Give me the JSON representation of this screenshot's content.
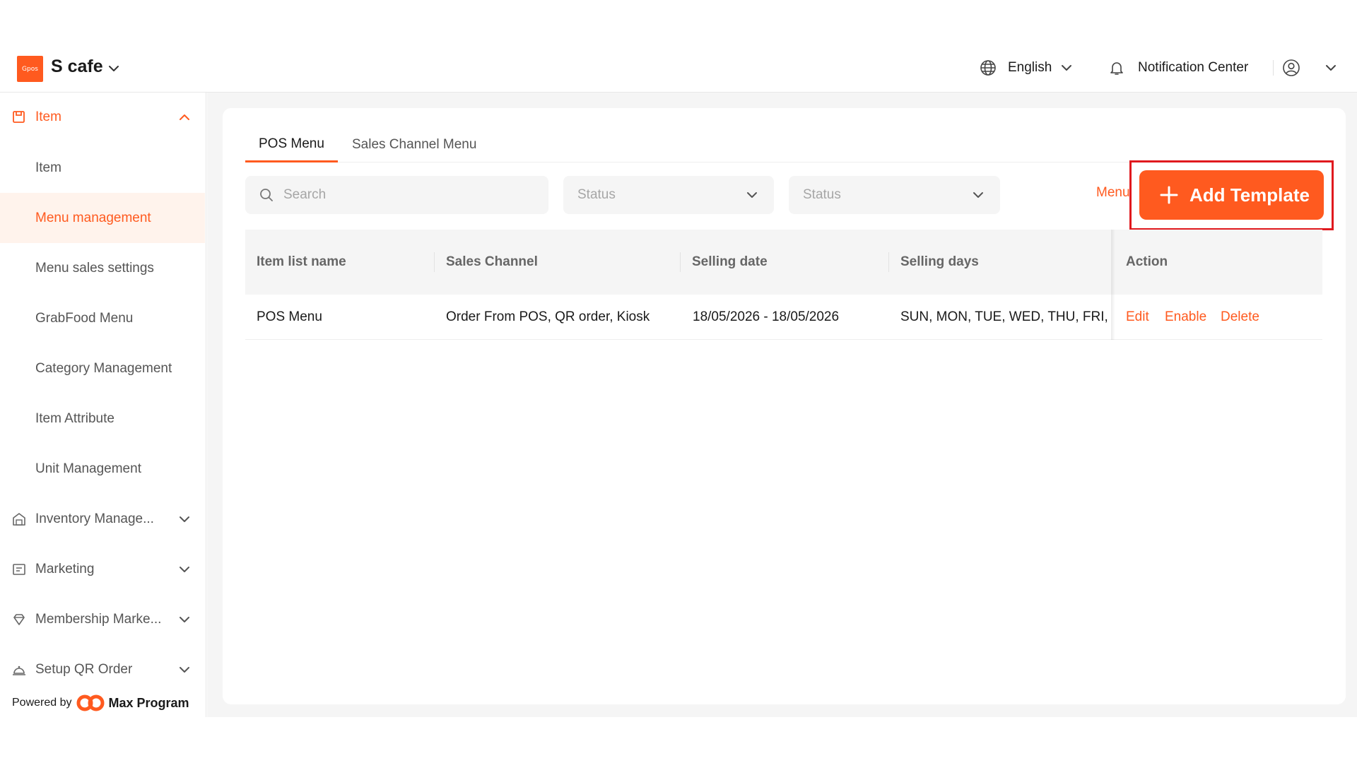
{
  "header": {
    "logo_text": "Gpos",
    "store_name": "S cafe",
    "language": "English",
    "notification_label": "Notification Center"
  },
  "sidebar": {
    "groups": [
      {
        "label": "Item",
        "icon": "item-box-icon",
        "expanded": true
      },
      {
        "label": "Inventory Manage...",
        "icon": "warehouse-icon",
        "expanded": false
      },
      {
        "label": "Marketing",
        "icon": "marketing-icon",
        "expanded": false
      },
      {
        "label": "Membership Marke...",
        "icon": "membership-icon",
        "expanded": false
      },
      {
        "label": "Setup QR Order",
        "icon": "service-bell-icon",
        "expanded": false
      }
    ],
    "items": [
      {
        "label": "Item"
      },
      {
        "label": "Menu management",
        "selected": true
      },
      {
        "label": "Menu sales settings"
      },
      {
        "label": "GrabFood Menu"
      },
      {
        "label": "Category Management"
      },
      {
        "label": "Item Attribute"
      },
      {
        "label": "Unit Management"
      }
    ],
    "powered_by": "Powered by",
    "powered_brand": "Max Program"
  },
  "tabs": [
    {
      "label": "POS Menu",
      "active": true
    },
    {
      "label": "Sales Channel Menu",
      "active": false
    }
  ],
  "filters": {
    "search_placeholder": "Search",
    "status_1": "Status",
    "status_2": "Status",
    "menu_link": "Menu"
  },
  "add_button_label": "Add Template",
  "table": {
    "columns": [
      "Item list name",
      "Sales Channel",
      "Selling date",
      "Selling days",
      "Action"
    ],
    "rows": [
      {
        "name": "POS Menu",
        "channel": "Order From POS, QR order, Kiosk",
        "date": "18/05/2026 - 18/05/2026",
        "days": "SUN, MON, TUE, WED, THU, FRI, SAT",
        "actions": [
          "Edit",
          "Enable",
          "Delete"
        ]
      }
    ]
  },
  "colors": {
    "accent": "#ff5a1f",
    "highlight": "#e0191e",
    "selected_bg": "#fff3ec"
  }
}
